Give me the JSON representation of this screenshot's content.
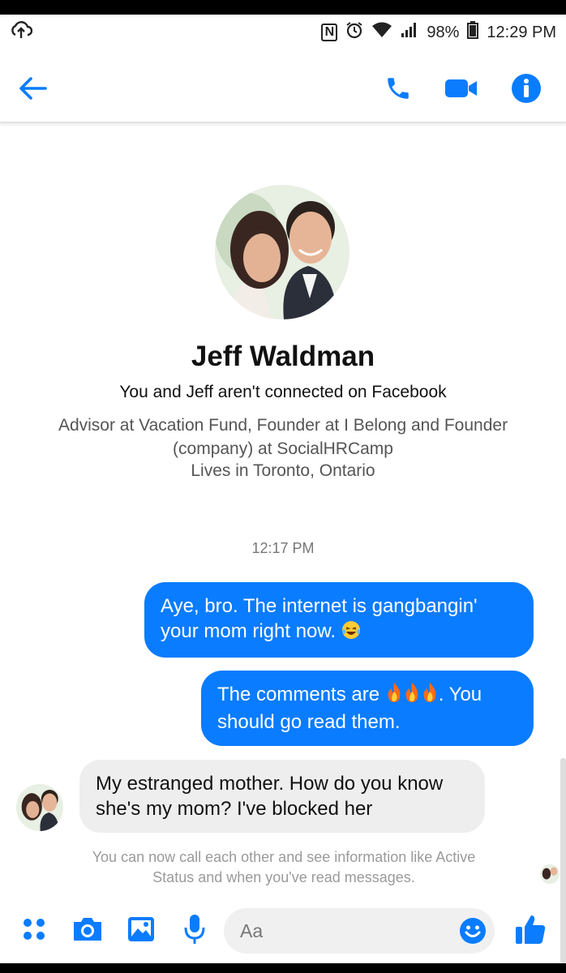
{
  "status_bar": {
    "battery": "98%",
    "time": "12:29 PM",
    "nfc_label": "N"
  },
  "header": {
    "back_icon": "arrow-left-icon",
    "call_icon": "phone-icon",
    "video_icon": "video-camera-icon",
    "info_icon": "info-icon",
    "accent": "#0a7cff"
  },
  "profile": {
    "name": "Jeff Waldman",
    "connection_status": "You and Jeff aren't connected on Facebook",
    "work": "Advisor at Vacation Fund, Founder at I Belong and Founder (company) at SocialHRCamp",
    "lives": "Lives in Toronto, Ontario"
  },
  "conversation": {
    "timestamp": "12:17 PM",
    "messages": [
      {
        "direction": "outgoing",
        "text": "Aye, bro. The internet is gangbangin' your mom right now.",
        "emoji": "laughing-tears"
      },
      {
        "direction": "outgoing",
        "text_before": "The comments are",
        "emoji": "fire x3",
        "text_after": ". You should go read them."
      },
      {
        "direction": "incoming",
        "text": "My estranged mother. How do you know she's my mom? I've blocked her"
      }
    ],
    "notice": "You can now call each other and see information like Active Status and when you've read messages."
  },
  "composer": {
    "placeholder": "Aa",
    "icons": [
      "grid-dots-icon",
      "camera-icon",
      "image-icon",
      "microphone-icon",
      "emoji-icon",
      "thumbs-up-icon"
    ]
  },
  "colors": {
    "outgoing_bubble": "#0a7cff",
    "incoming_bubble": "#eeeeee",
    "icon_blue": "#0a7cff"
  }
}
